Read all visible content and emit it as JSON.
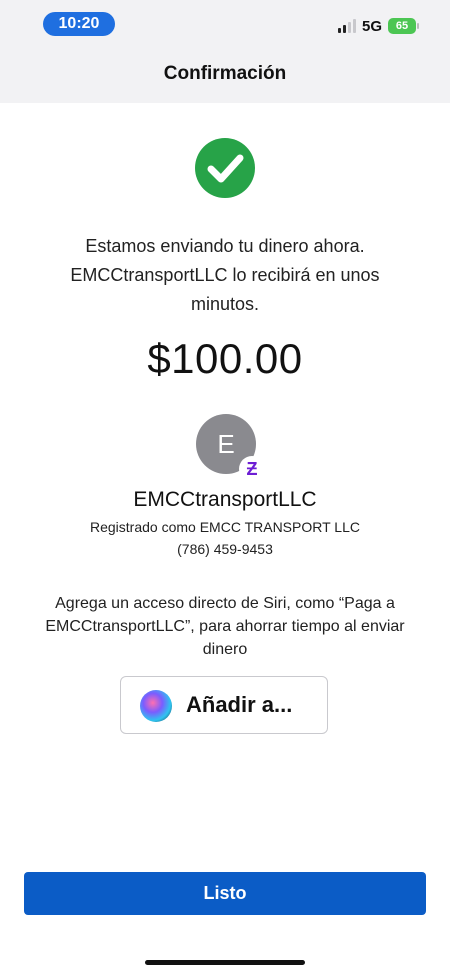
{
  "status_bar": {
    "time": "10:20",
    "network": "5G",
    "battery": "65"
  },
  "header": {
    "title": "Confirmación"
  },
  "confirmation": {
    "message": "Estamos enviando tu dinero ahora. EMCCtransportLLC lo recibirá en unos minutos.",
    "amount": "$100.00",
    "icon": "checkmark-circle-icon"
  },
  "recipient": {
    "initial": "E",
    "badge": "Ƶ",
    "name": "EMCCtransportLLC",
    "registered": "Registrado como EMCC TRANSPORT LLC",
    "phone": "(786) 459-9453"
  },
  "siri": {
    "text": "Agrega un acceso directo de Siri, como “Paga a EMCCtransportLLC”, para ahorrar tiempo al enviar dinero",
    "button_label": "Añadir a..."
  },
  "footer": {
    "done_label": "Listo"
  },
  "colors": {
    "accent": "#0b5cc6",
    "success": "#27a348",
    "zelle": "#6d1ed4"
  }
}
